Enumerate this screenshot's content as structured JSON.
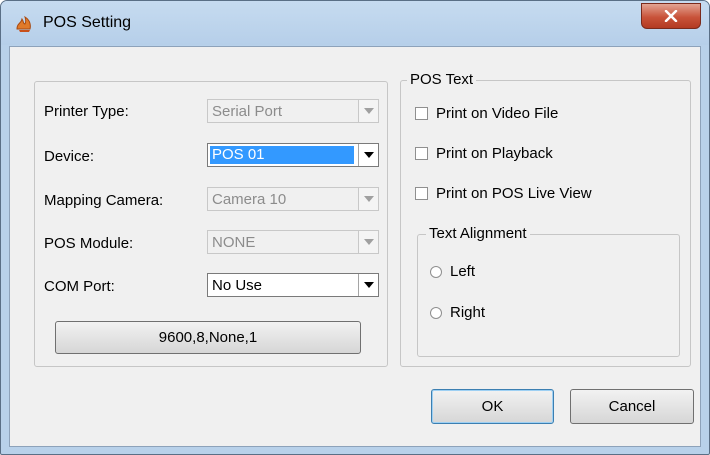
{
  "window": {
    "title": "POS Setting",
    "close_symbol": "x",
    "title_icon": "app-flame-icon"
  },
  "device_group": {
    "fields": [
      {
        "label": "Printer Type:",
        "value": "Serial Port",
        "enabled": false
      },
      {
        "label": "Device:",
        "value": "POS 01",
        "enabled": true,
        "selected": true
      },
      {
        "label": "Mapping Camera:",
        "value": "Camera 10",
        "enabled": false
      },
      {
        "label": "POS Module:",
        "value": "NONE",
        "enabled": false
      },
      {
        "label": "COM Port:",
        "value": "No Use",
        "enabled": true
      }
    ],
    "serial_settings_button": "9600,8,None,1"
  },
  "pos_text": {
    "legend": "POS Text",
    "options": [
      {
        "label": "Print on Video File",
        "checked": false
      },
      {
        "label": "Print on Playback",
        "checked": false
      },
      {
        "label": "Print on POS Live View",
        "checked": false
      }
    ],
    "alignment": {
      "legend": "Text Alignment",
      "options": [
        {
          "label": "Left",
          "selected": false
        },
        {
          "label": "Right",
          "selected": false
        }
      ]
    }
  },
  "buttons": {
    "ok": "OK",
    "cancel": "Cancel"
  },
  "colors": {
    "title_bar": "#b8d1ea",
    "close_button": "#c9533a",
    "selection": "#3399ff",
    "dialog_face": "#f0f0f0"
  }
}
